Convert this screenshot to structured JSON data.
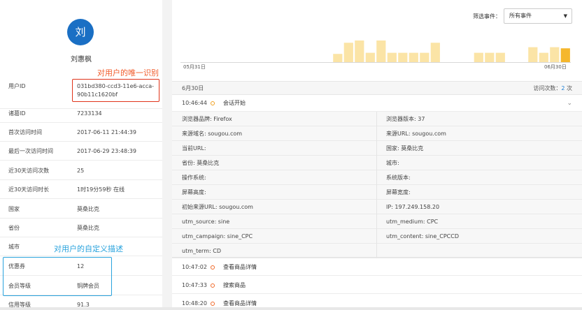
{
  "profile": {
    "avatar_char": "刘",
    "name": "刘惠枫",
    "fields": [
      {
        "key": "用户ID",
        "value": "031bd380-ccd3-11e6-acca-90b11c1620bf"
      },
      {
        "key": "诸葛ID",
        "value": "7233134"
      },
      {
        "key": "首次访问时间",
        "value": "2017-06-11 21:44:39"
      },
      {
        "key": "最后一次访问时间",
        "value": "2017-06-29 23:48:39"
      },
      {
        "key": "近30天访问次数",
        "value": "25"
      },
      {
        "key": "近30天访问时长",
        "value": "1时19分59秒 在线"
      },
      {
        "key": "国家",
        "value": "莫桑比克"
      },
      {
        "key": "省份",
        "value": "莫桑比克"
      },
      {
        "key": "城市",
        "value": ""
      },
      {
        "key": "优惠券",
        "value": "12"
      },
      {
        "key": "会员等级",
        "value": "铜牌会员"
      },
      {
        "key": "信用等级",
        "value": "91.3"
      }
    ]
  },
  "annotations": {
    "unique_id": "对用户的唯一识别",
    "custom_desc": "对用户的自定义描述"
  },
  "filter": {
    "label": "筛选事件：",
    "selected": "所有事件"
  },
  "chart_data": {
    "type": "bar",
    "x_start_label": "05月31日",
    "x_end_label": "06月30日",
    "values": [
      0,
      0,
      0,
      0,
      0,
      0,
      0,
      0,
      0,
      0,
      0,
      0,
      0,
      0,
      0.4,
      0.9,
      1,
      0.45,
      1,
      0.45,
      0.45,
      0.45,
      0.45,
      0.9,
      0,
      0,
      0,
      0.45,
      0.45,
      0.45,
      0,
      0,
      0.7,
      0.45,
      0.7,
      0.65
    ],
    "bar_color": "#fbe4a6",
    "highlight_color": "#f5b72d",
    "highlight_index": 35
  },
  "session": {
    "date": "6月30日",
    "visits_label": "访问次数：",
    "visits_count": "2",
    "visits_unit": "次",
    "start_time": "10:46:44",
    "start_name": "会话开始"
  },
  "details": [
    [
      "浏览器品牌: Firefox",
      "浏览器版本: 37"
    ],
    [
      "来源域名: sougou.com",
      "来源URL: sougou.com"
    ],
    [
      "当前URL:",
      "国家: 莫桑比克"
    ],
    [
      "省份: 莫桑比克",
      "城市:"
    ],
    [
      "操作系统:",
      "系统版本:"
    ],
    [
      "屏幕高度:",
      "屏幕宽度:"
    ],
    [
      "初始来源URL: sougou.com",
      "IP: 197.249.158.20"
    ],
    [
      "utm_source: sine",
      "utm_medium: CPC"
    ],
    [
      "utm_campaign: sine_CPC",
      "utm_content: sine_CPCCD"
    ],
    [
      "utm_term: CD",
      ""
    ]
  ],
  "events": [
    {
      "time": "10:47:02",
      "name": "查看商品详情"
    },
    {
      "time": "10:47:33",
      "name": "搜索商品"
    },
    {
      "time": "10:48:20",
      "name": "查看商品详情"
    }
  ]
}
